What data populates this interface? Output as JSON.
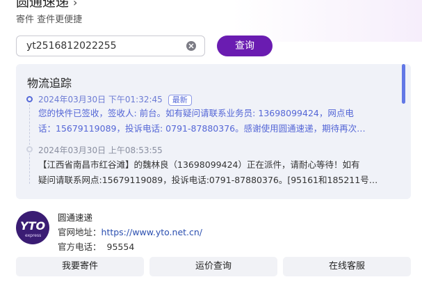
{
  "header": {
    "title": "圆通速递",
    "subtitle": "寄件 查件更便捷"
  },
  "search": {
    "value": "yt2516812022255",
    "query_label": "查询"
  },
  "tracking": {
    "title": "物流追踪",
    "events": [
      {
        "time": "2024年03月30日 下午01:32:45",
        "badge": "最新",
        "line1": "您的快件已签收，签收人: 前台。如有疑问请联系业务员: 13698099424，网点电",
        "line2": "话：15679119089，投诉电话: 0791-87880376。感谢使用圆通速递，期待再次…"
      },
      {
        "time": "2024年03月30日 上午08:53:55",
        "line1": "【江西省南昌市红谷滩】的魏林良（13698099424）正在派件，请耐心等待！如有",
        "line2": "疑问请联系网点:15679119089，投诉电话:0791-87880376。[95161和185211号…"
      }
    ]
  },
  "company": {
    "logo_text": "YTO",
    "logo_sub": "express",
    "name": "圆通速递",
    "website_label": "官网地址：",
    "website": "https://www.yto.net.cn/",
    "phone_label": "官方电话：",
    "phone": "95554"
  },
  "actions": {
    "send": "我要寄件",
    "price": "运价查询",
    "service": "在线客服"
  },
  "colors": {
    "accent": "#6a1cb1",
    "timeline_active": "#5569d8",
    "panel_bg": "#f0f2f8"
  }
}
